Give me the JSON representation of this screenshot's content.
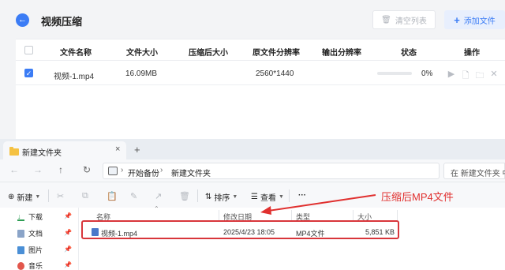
{
  "app": {
    "title": "视频压缩",
    "back_icon": "arrow-left-icon",
    "clear_button": "清空列表",
    "add_button": "添加文件",
    "columns": [
      "文件名称",
      "文件大小",
      "压缩后大小",
      "原文件分辨率",
      "输出分辨率",
      "状态",
      "操作"
    ],
    "rows": [
      {
        "checked": true,
        "name": "视频-1.mp4",
        "size": "16.09MB",
        "compressed_size": "",
        "original_resolution": "2560*1440",
        "output_resolution": "",
        "progress_percent": 0,
        "status": "0%",
        "actions": [
          "play-icon",
          "document-icon",
          "folder-icon",
          "close-icon"
        ]
      }
    ],
    "accent_color": "#3b7cf5"
  },
  "explorer": {
    "tab_title": "新建文件夹",
    "tab_close": "×",
    "new_tab": "+",
    "breadcrumbs": [
      "开始备份",
      "新建文件夹"
    ],
    "search_placeholder": "在 新建文件夹 中",
    "toolbar": {
      "new": "新建",
      "sort": "排序",
      "view": "查看",
      "more": "···"
    },
    "sidebar": [
      {
        "label": "下载",
        "icon": "download-icon"
      },
      {
        "label": "文档",
        "icon": "document-icon"
      },
      {
        "label": "图片",
        "icon": "picture-icon"
      },
      {
        "label": "音乐",
        "icon": "music-icon"
      }
    ],
    "columns": [
      "名称",
      "修改日期",
      "类型",
      "大小"
    ],
    "files": [
      {
        "name": "视频-1.mp4",
        "modified": "2025/4/23 18:05",
        "type": "MP4文件",
        "size": "5,851 KB"
      }
    ]
  },
  "annotation": {
    "text": "压缩后MP4文件",
    "color": "#e0302f"
  }
}
